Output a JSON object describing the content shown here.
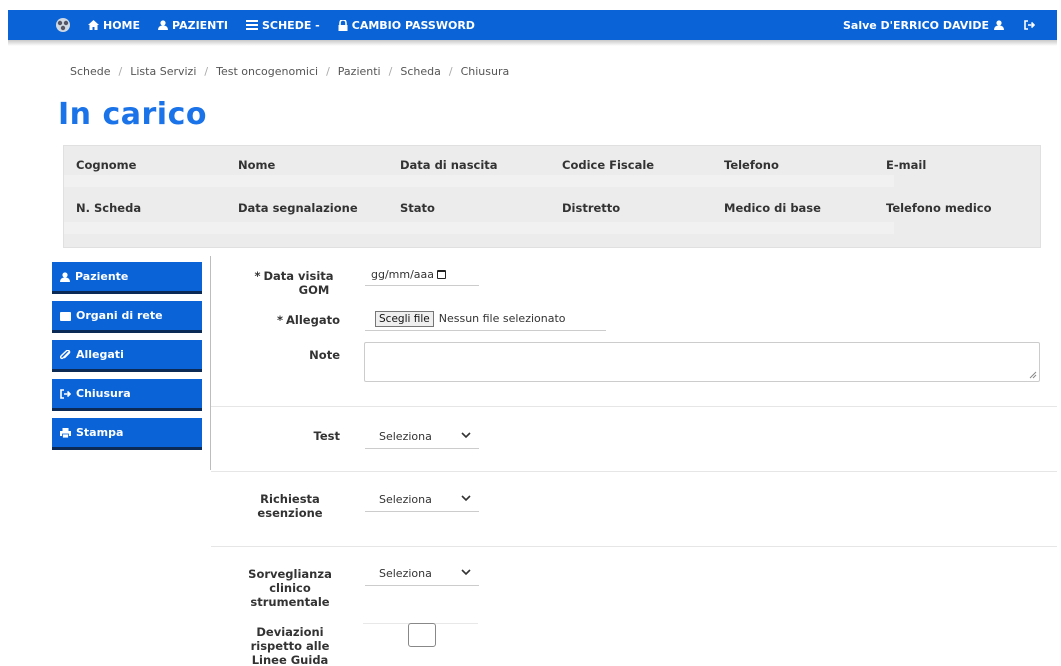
{
  "nav": {
    "home": "HOME",
    "pazienti": "PAZIENTI",
    "schede": "SCHEDE -",
    "cambio_password": "CAMBIO PASSWORD",
    "user": "Salve D'ERRICO DAVIDE"
  },
  "breadcrumb": [
    "Schede",
    "Lista Servizi",
    "Test oncogenomici",
    "Pazienti",
    "Scheda",
    "Chiusura"
  ],
  "page_title": "In carico",
  "info": {
    "row1": [
      "Cognome",
      "Nome",
      "Data di nascita",
      "Codice Fiscale",
      "Telefono",
      "E-mail"
    ],
    "row2": [
      "N. Scheda",
      "Data segnalazione",
      "Stato",
      "Distretto",
      "Medico di base",
      "Telefono medico"
    ]
  },
  "sidebar": {
    "items": [
      {
        "label": "Paziente",
        "icon": "user-icon"
      },
      {
        "label": "Organi di rete",
        "icon": "folder-icon"
      },
      {
        "label": "Allegati",
        "icon": "paperclip-icon"
      },
      {
        "label": "Chiusura",
        "icon": "sign-out-icon"
      },
      {
        "label": "Stampa",
        "icon": "print-icon"
      }
    ]
  },
  "form": {
    "data_visita_label_1": "Data visita",
    "data_visita_label_2": "GOM",
    "required_mark": "*",
    "date_placeholder": "gg/mm/aaa",
    "allegato_label": "Allegato",
    "file_button": "Scegli file",
    "file_status": "Nessun file selezionato",
    "note_label": "Note",
    "test_label": "Test",
    "test_value": "Seleziona",
    "esenzione_label_1": "Richiesta",
    "esenzione_label_2": "esenzione",
    "esenzione_value": "Seleziona",
    "sorveglianza_label_1": "Sorveglianza",
    "sorveglianza_label_2": "clinico",
    "sorveglianza_label_3": "strumentale",
    "sorveglianza_value": "Seleziona",
    "deviazioni_label_1": "Deviazioni",
    "deviazioni_label_2": "rispetto alle",
    "deviazioni_label_3": "Linee Guida"
  },
  "colors": {
    "brand_blue": "#0a64d8",
    "title_blue": "#1a73e8",
    "panel_gray": "#ececec"
  }
}
